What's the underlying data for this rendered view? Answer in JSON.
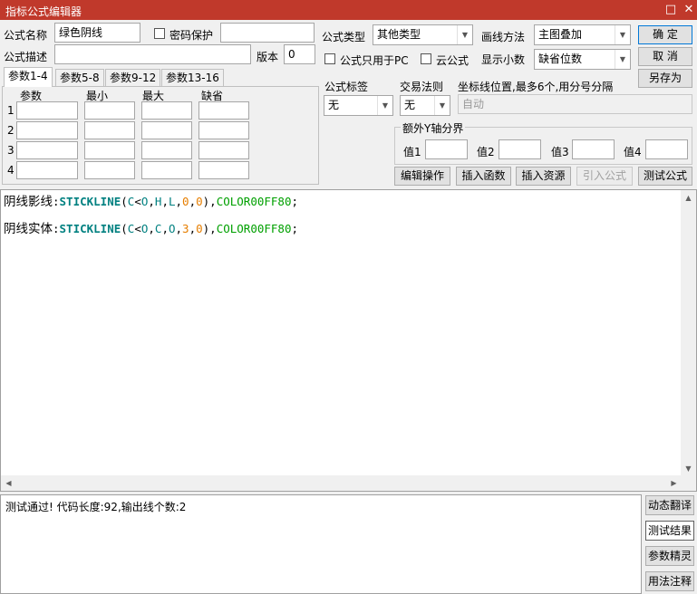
{
  "window": {
    "title": "指标公式编辑器",
    "maximize_glyph": "□",
    "close_glyph": "✕"
  },
  "form": {
    "name_label": "公式名称",
    "name_value": "绿色阴线",
    "password_label": "密码保护",
    "password_value": "",
    "desc_label": "公式描述",
    "desc_value": "",
    "version_label": "版本",
    "version_value": "0",
    "type_label": "公式类型",
    "type_value": "其他类型",
    "draw_label": "画线方法",
    "draw_value": "主图叠加",
    "pc_only_label": "公式只用于PC",
    "cloud_label": "云公式",
    "decimals_label": "显示小数",
    "decimals_value": "缺省位数",
    "tag_label": "公式标签",
    "tag_value": "无",
    "trade_label": "交易法则",
    "trade_value": "无",
    "coord_label": "坐标线位置,最多6个,用分号分隔",
    "coord_value": "自动",
    "yaxis_group": "额外Y轴分界",
    "y1_label": "值1",
    "y2_label": "值2",
    "y3_label": "值3",
    "y4_label": "值4"
  },
  "buttons": {
    "ok": "确  定",
    "cancel": "取  消",
    "save_as": "另存为",
    "edit_ops": "编辑操作",
    "insert_func": "插入函数",
    "insert_res": "插入资源",
    "import_formula": "引入公式",
    "test_formula": "测试公式"
  },
  "params": {
    "tabs": [
      "参数1-4",
      "参数5-8",
      "参数9-12",
      "参数13-16"
    ],
    "headers": [
      "参数",
      "最小",
      "最大",
      "缺省"
    ],
    "rows": [
      "1",
      "2",
      "3",
      "4"
    ]
  },
  "code": {
    "line1_name": "阴线影线",
    "line2_name": "阴线实体",
    "colon": ":",
    "stickline": "STICKLINE",
    "lp": "(",
    "rp": ")",
    "comma": ",",
    "semi": ";",
    "c": "C",
    "lt": "<",
    "o": "O",
    "h": "H",
    "l": "L",
    "zero": "0",
    "three": "3",
    "color": "COLOR00FF80"
  },
  "output": {
    "text": "测试通过! 代码长度:92,输出线个数:2"
  },
  "side_buttons": [
    "动态翻译",
    "测试结果",
    "参数精灵",
    "用法注释"
  ]
}
